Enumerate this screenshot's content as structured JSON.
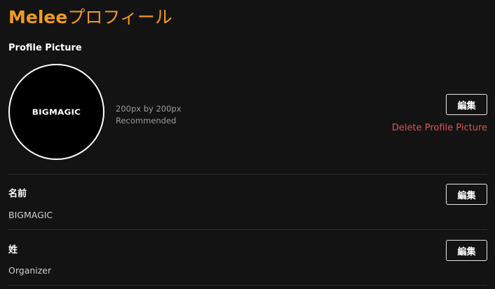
{
  "page": {
    "title_brand": "Melee",
    "title_suffix": "プロフィール",
    "accent_color": "#f39a1c"
  },
  "profile_picture": {
    "label": "Profile Picture",
    "avatar_text": "BIGMAGIC",
    "size_hint": "200px by 200px",
    "recommend_hint": "Recommended",
    "edit_label": "編集",
    "delete_label": "Delete Profile Picture",
    "delete_color": "#d9534f"
  },
  "first_name": {
    "label": "名前",
    "value": "BIGMAGIC",
    "edit_label": "編集"
  },
  "last_name": {
    "label": "姓",
    "value": "Organizer",
    "edit_label": "編集"
  }
}
